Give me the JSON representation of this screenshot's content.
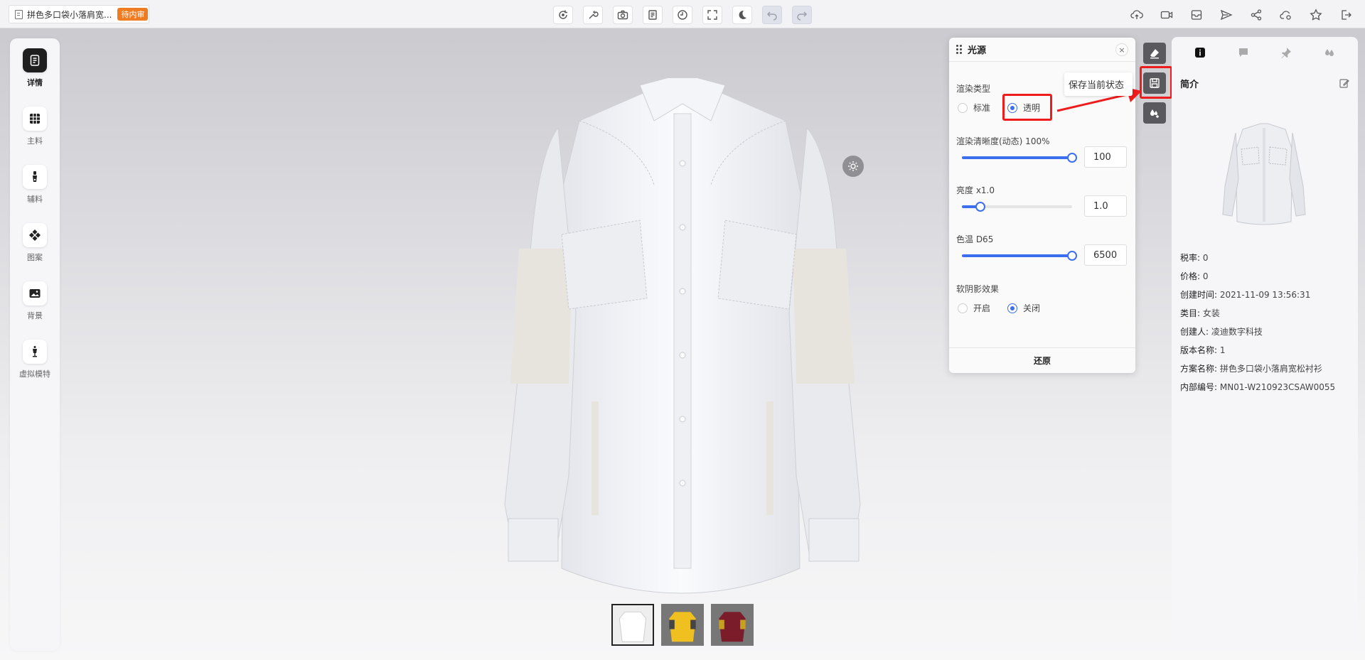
{
  "topbar": {
    "doc_title": "拼色多口袋小落肩宽...",
    "status_badge": "待内审"
  },
  "left_nav": [
    {
      "label": "详情",
      "icon": "document-icon",
      "active": true
    },
    {
      "label": "主料",
      "icon": "fabric-grid-icon",
      "active": false
    },
    {
      "label": "辅料",
      "icon": "zipper-icon",
      "active": false
    },
    {
      "label": "图案",
      "icon": "pattern-icon",
      "active": false
    },
    {
      "label": "背景",
      "icon": "image-icon",
      "active": false
    },
    {
      "label": "虚拟模特",
      "icon": "mannequin-icon",
      "active": false
    }
  ],
  "light_panel": {
    "title": "光源",
    "render_type_label": "渲染类型",
    "render_options": [
      {
        "label": "标准",
        "selected": false
      },
      {
        "label": "透明",
        "selected": true
      }
    ],
    "clarity_label": "渲染清晰度(动态) 100%",
    "clarity_value": "100",
    "clarity_fraction": 1.0,
    "brightness_label": "亮度 x1.0",
    "brightness_value": "1.0",
    "brightness_fraction": 0.17,
    "color_temp_label": "色温 D65",
    "color_temp_value": "6500",
    "color_temp_fraction": 1.0,
    "soft_shadow_label": "软阴影效果",
    "shadow_options": [
      {
        "label": "开启",
        "selected": false
      },
      {
        "label": "关闭",
        "selected": true
      }
    ],
    "reset_label": "还原"
  },
  "tooltip": "保存当前状态",
  "info_panel": {
    "title": "简介",
    "rows": [
      {
        "key": "税率:",
        "value": "0"
      },
      {
        "key": "价格:",
        "value": "0"
      },
      {
        "key": "创建时间:",
        "value": "2021-11-09 13:56:31"
      },
      {
        "key": "类目:",
        "value": "女装"
      },
      {
        "key": "创建人:",
        "value": "凌迪数字科技"
      },
      {
        "key": "版本名称:",
        "value": "1"
      },
      {
        "key": "方案名称:",
        "value": "拼色多口袋小落肩宽松衬衫"
      },
      {
        "key": "内部编号:",
        "value": "MN01-W210923CSAW0055"
      }
    ]
  },
  "colors": {
    "accent": "#3c6ef0",
    "badge": "#f07c22",
    "highlight": "#ee1c1c"
  }
}
